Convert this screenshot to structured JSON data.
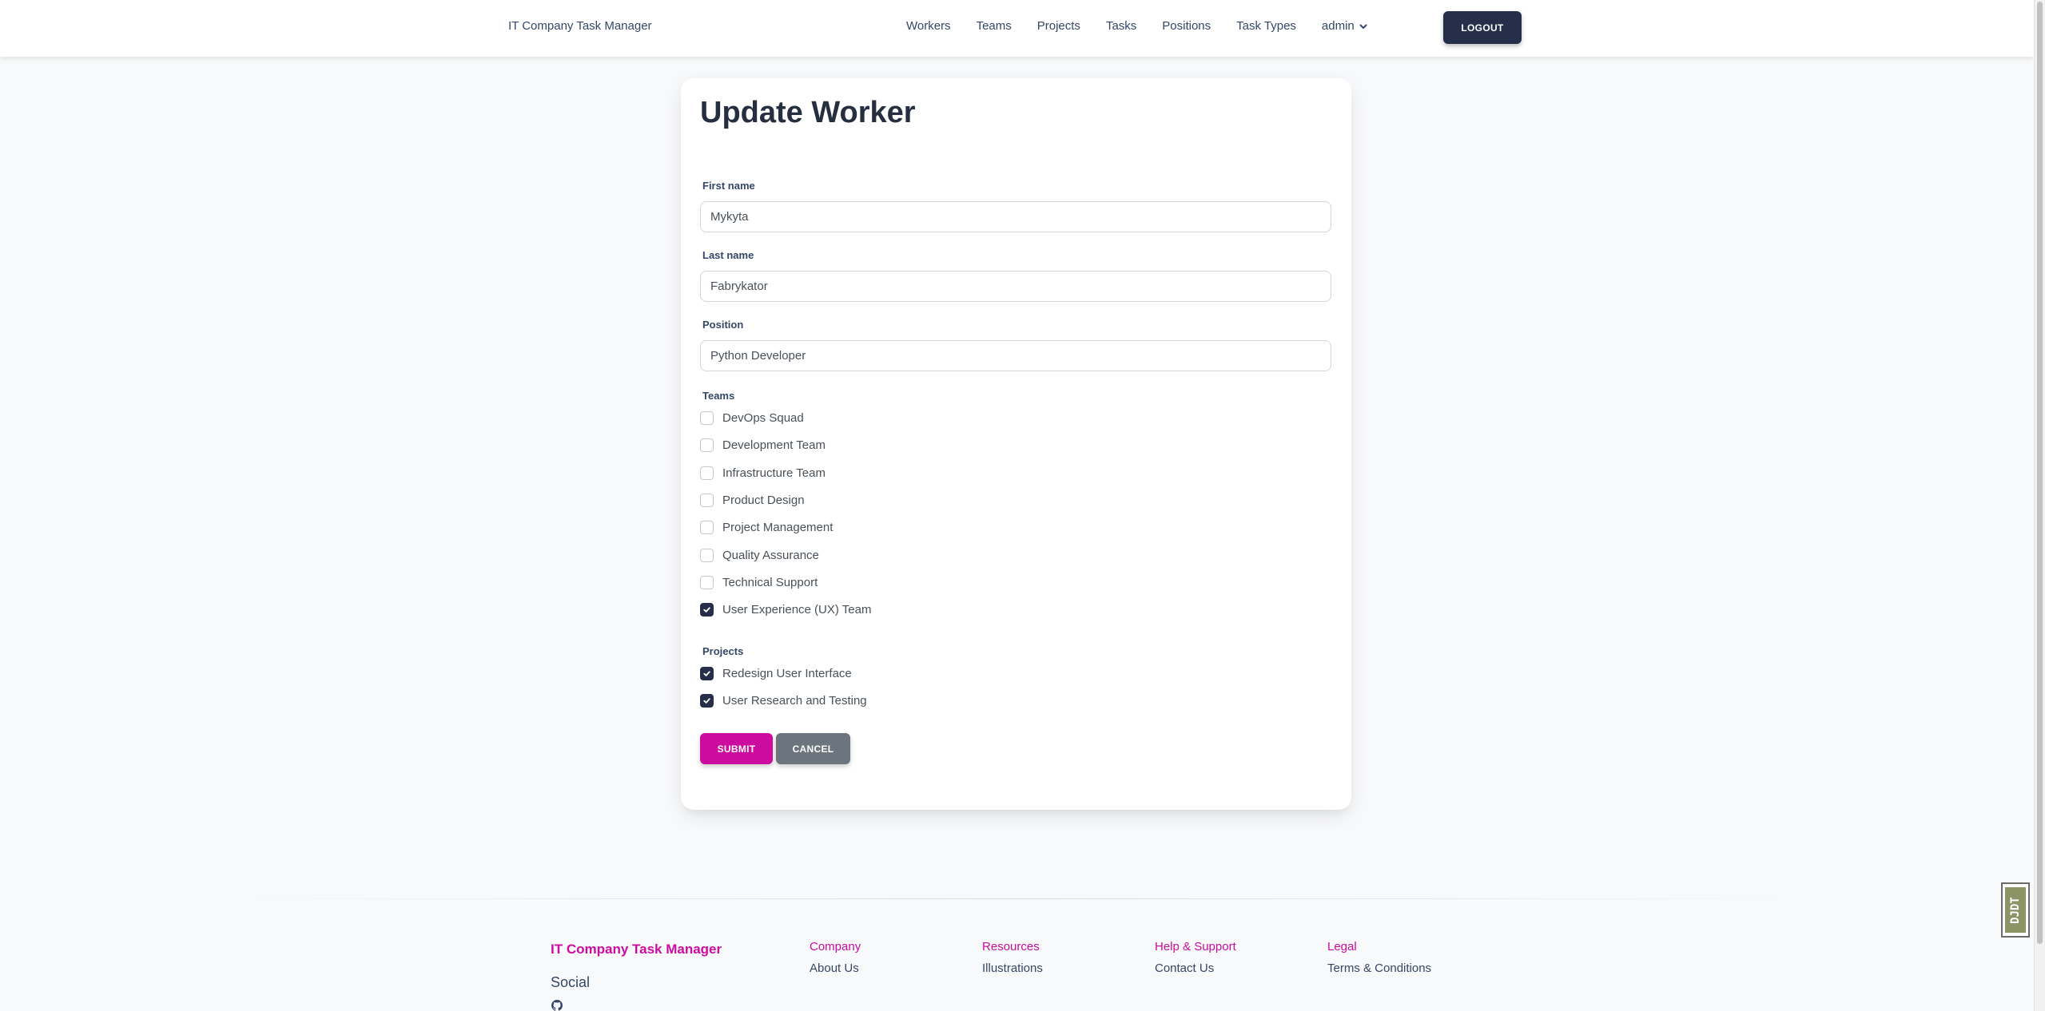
{
  "navbar": {
    "brand": "IT Company Task Manager",
    "links": [
      "Workers",
      "Teams",
      "Projects",
      "Tasks",
      "Positions",
      "Task Types"
    ],
    "user_menu": "admin",
    "logout_label": "LOGOUT"
  },
  "form": {
    "title": "Update Worker",
    "first_name_label": "First name",
    "first_name_value": "Mykyta",
    "last_name_label": "Last name",
    "last_name_value": "Fabrykator",
    "position_label": "Position",
    "position_value": "Python Developer",
    "teams_label": "Teams",
    "teams": [
      {
        "label": "DevOps Squad",
        "checked": false
      },
      {
        "label": "Development Team",
        "checked": false
      },
      {
        "label": "Infrastructure Team",
        "checked": false
      },
      {
        "label": "Product Design",
        "checked": false
      },
      {
        "label": "Project Management",
        "checked": false
      },
      {
        "label": "Quality Assurance",
        "checked": false
      },
      {
        "label": "Technical Support",
        "checked": false
      },
      {
        "label": "User Experience (UX) Team",
        "checked": true
      }
    ],
    "projects_label": "Projects",
    "projects": [
      {
        "label": "Redesign User Interface",
        "checked": true
      },
      {
        "label": "User Research and Testing",
        "checked": true
      }
    ],
    "submit_label": "SUBMIT",
    "cancel_label": "CANCEL"
  },
  "footer": {
    "brand": "IT Company Task Manager",
    "social_label": "Social",
    "columns": [
      {
        "heading": "Company",
        "link": "About Us"
      },
      {
        "heading": "Resources",
        "link": "Illustrations"
      },
      {
        "heading": "Help & Support",
        "link": "Contact Us"
      },
      {
        "heading": "Legal",
        "link": "Terms & Conditions"
      }
    ]
  },
  "side_widget": {
    "text": "DJDT"
  },
  "colors": {
    "primary": "#cb0c9f",
    "dark": "#252f4a",
    "secondary": "#6c757d",
    "text": "#344767"
  },
  "icons": {
    "user_menu": "chevron-down-icon",
    "checkbox": "check-icon",
    "social": "github-icon"
  }
}
